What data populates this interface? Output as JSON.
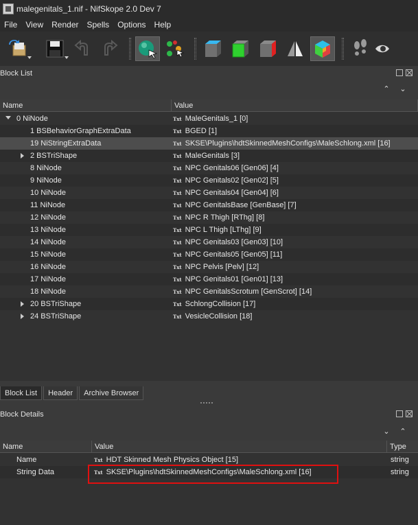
{
  "window": {
    "title": "malegenitals_1.nif - NifSkope 2.0 Dev 7"
  },
  "menu": [
    "File",
    "View",
    "Render",
    "Spells",
    "Options",
    "Help"
  ],
  "toolbar": {
    "buttons": [
      "load-icon",
      "save-icon",
      "undo-icon",
      "redo-icon",
      "select-object-icon",
      "spells-icon",
      "view-box-icon",
      "view-green-box-icon",
      "view-red-box-icon",
      "view-flip-icon",
      "view-color-cube-icon",
      "walk-icon",
      "eye-icon"
    ]
  },
  "block_list": {
    "title": "Block List",
    "columns": [
      "Name",
      "Value"
    ],
    "rows": [
      {
        "name": "0 NiNode",
        "value": "MaleGenitals_1 [0]",
        "expander": "open",
        "txt": false
      },
      {
        "name": "1 BSBehaviorGraphExtraData",
        "value": "BGED [1]",
        "expander": "",
        "txt": true
      },
      {
        "name": "19 NiStringExtraData",
        "value": "SKSE\\Plugins\\hdtSkinnedMeshConfigs\\MaleSchlong.xml [16]",
        "expander": "",
        "txt": true,
        "selected": true
      },
      {
        "name": "2 BSTriShape",
        "value": "MaleGenitals [3]",
        "expander": "closed",
        "txt": false
      },
      {
        "name": "8 NiNode",
        "value": "NPC Genitals06 [Gen06] [4]",
        "expander": "",
        "txt": false
      },
      {
        "name": "9 NiNode",
        "value": "NPC Genitals02 [Gen02] [5]",
        "expander": "",
        "txt": false
      },
      {
        "name": "10 NiNode",
        "value": "NPC Genitals04 [Gen04] [6]",
        "expander": "",
        "txt": false
      },
      {
        "name": "11 NiNode",
        "value": "NPC GenitalsBase [GenBase] [7]",
        "expander": "",
        "txt": false
      },
      {
        "name": "12 NiNode",
        "value": "NPC R Thigh [RThg] [8]",
        "expander": "",
        "txt": false
      },
      {
        "name": "13 NiNode",
        "value": "NPC L Thigh [LThg] [9]",
        "expander": "",
        "txt": false
      },
      {
        "name": "14 NiNode",
        "value": "NPC Genitals03 [Gen03] [10]",
        "expander": "",
        "txt": false
      },
      {
        "name": "15 NiNode",
        "value": "NPC Genitals05 [Gen05] [11]",
        "expander": "",
        "txt": false
      },
      {
        "name": "16 NiNode",
        "value": "NPC Pelvis [Pelv] [12]",
        "expander": "",
        "txt": false
      },
      {
        "name": "17 NiNode",
        "value": "NPC Genitals01 [Gen01] [13]",
        "expander": "",
        "txt": false
      },
      {
        "name": "18 NiNode",
        "value": "NPC GenitalsScrotum [GenScrot] [14]",
        "expander": "",
        "txt": false
      },
      {
        "name": "20 BSTriShape",
        "value": "SchlongCollision [17]",
        "expander": "closed",
        "txt": false
      },
      {
        "name": "24 BSTriShape",
        "value": "VesicleCollision [18]",
        "expander": "closed",
        "txt": false
      }
    ]
  },
  "tabs": [
    "Block List",
    "Header",
    "Archive Browser"
  ],
  "block_details": {
    "title": "Block Details",
    "columns": [
      "Name",
      "Value",
      "Type"
    ],
    "rows": [
      {
        "name": "Name",
        "value": "HDT Skinned Mesh Physics Object [15]",
        "type": "string"
      },
      {
        "name": "String Data",
        "value": "SKSE\\Plugins\\hdtSkinnedMeshConfigs\\MaleSchlong.xml [16]",
        "type": "string"
      }
    ]
  },
  "txt_icon_label": "Txt",
  "colors": {
    "background": "#3a3a3a",
    "selected_row": "#4d4d4d",
    "highlight_border": "#e01010"
  }
}
